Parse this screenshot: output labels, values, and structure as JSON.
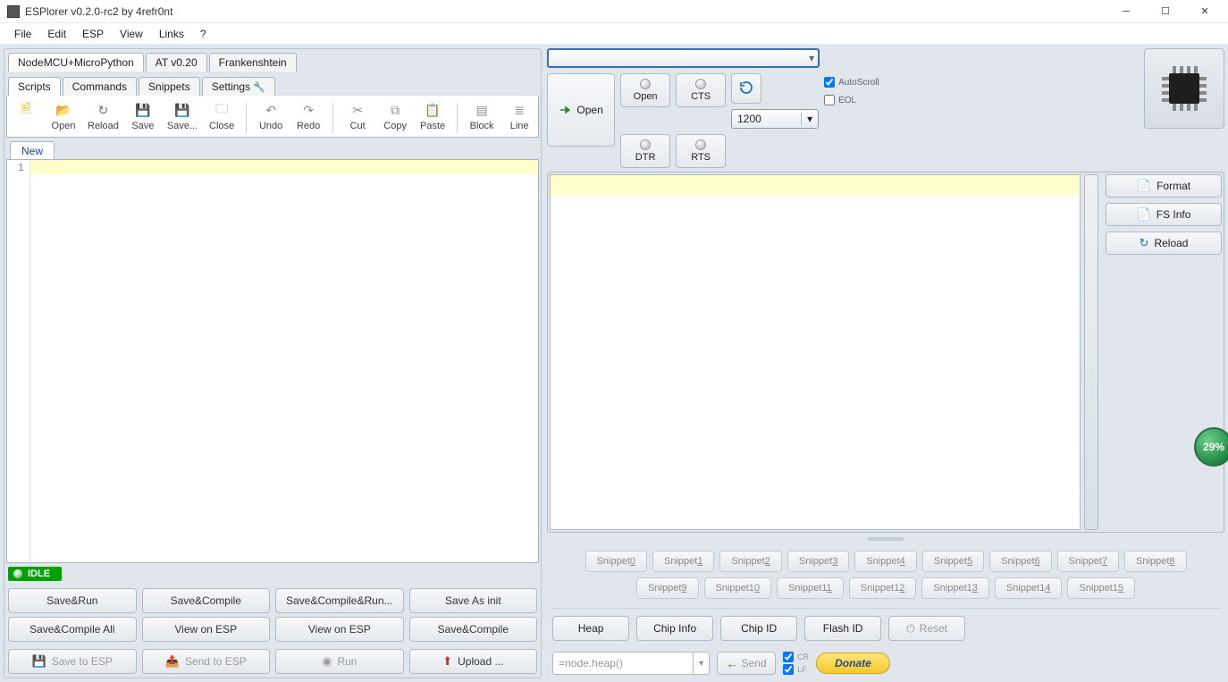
{
  "window": {
    "title": "ESPlorer v0.2.0-rc2 by 4refr0nt"
  },
  "menus": [
    "File",
    "Edit",
    "ESP",
    "View",
    "Links",
    "?"
  ],
  "firmware_tabs": [
    "NodeMCU+MicroPython",
    "AT v0.20",
    "Frankenshtein"
  ],
  "sub_tabs": [
    "Scripts",
    "Commands",
    "Snippets",
    "Settings"
  ],
  "toolbar": [
    {
      "id": "open-folder",
      "label": "Open",
      "glyph": "📂",
      "cls": "ic-folder-open"
    },
    {
      "id": "reload",
      "label": "Reload",
      "glyph": "↻",
      "cls": "ic-reload"
    },
    {
      "id": "save",
      "label": "Save",
      "glyph": "💾",
      "cls": "ic-save"
    },
    {
      "id": "saveas",
      "label": "Save...",
      "glyph": "💾",
      "cls": "ic-saveas"
    },
    {
      "id": "close",
      "label": "Close",
      "glyph": "🗀",
      "cls": "ic-close"
    },
    {
      "id": "SEP"
    },
    {
      "id": "undo",
      "label": "Undo",
      "glyph": "↶",
      "cls": "ic-undo"
    },
    {
      "id": "redo",
      "label": "Redo",
      "glyph": "↷",
      "cls": "ic-redo"
    },
    {
      "id": "SEP"
    },
    {
      "id": "cut",
      "label": "Cut",
      "glyph": "✂",
      "cls": "ic-cut"
    },
    {
      "id": "copy",
      "label": "Copy",
      "glyph": "⧉",
      "cls": "ic-copy"
    },
    {
      "id": "paste",
      "label": "Paste",
      "glyph": "📋",
      "cls": "ic-paste"
    },
    {
      "id": "SEP"
    },
    {
      "id": "block",
      "label": "Block",
      "glyph": "▤",
      "cls": "ic-block"
    },
    {
      "id": "line",
      "label": "Line",
      "glyph": "≣",
      "cls": "ic-line"
    }
  ],
  "new_file_icon": "🗎",
  "editor": {
    "tab": "New",
    "line_number": "1"
  },
  "status": "IDLE",
  "left_buttons_row1": [
    "Save&Run",
    "Save&Compile",
    "Save&Compile&Run...",
    "Save As init"
  ],
  "left_buttons_row2": [
    "Save&Compile All",
    "View on ESP",
    "View on ESP",
    "Save&Compile"
  ],
  "left_buttons_row3": [
    {
      "label": "Save to ESP",
      "dim": true
    },
    {
      "label": "Send to ESP",
      "dim": true
    },
    {
      "label": "Run",
      "dim": true
    },
    {
      "label": "Upload ..."
    }
  ],
  "serial": {
    "port": "",
    "baud": "1200",
    "open_label": "Open",
    "big_open": "Open",
    "cts": "CTS",
    "dtr": "DTR",
    "rts": "RTS",
    "autoscroll": "AutoScroll",
    "autoscroll_checked": true,
    "eol": "EOL",
    "eol_checked": false
  },
  "side_buttons": [
    {
      "label": "Format",
      "icon": "📄",
      "color": "#c0392b"
    },
    {
      "label": "FS Info",
      "icon": "📄",
      "color": "#d08b1a"
    },
    {
      "label": "Reload",
      "icon": "↻",
      "color": "#1a73c4"
    }
  ],
  "gauge": "29%",
  "snippets": [
    "Snippet0",
    "Snippet1",
    "Snippet2",
    "Snippet3",
    "Snippet4",
    "Snippet5",
    "Snippet6",
    "Snippet7",
    "Snippet8",
    "Snippet9",
    "Snippet10",
    "Snippet11",
    "Snippet12",
    "Snippet13",
    "Snippet14",
    "Snippet15"
  ],
  "chip_buttons": [
    "Heap",
    "Chip Info",
    "Chip ID",
    "Flash ID",
    "Reset"
  ],
  "cmd": {
    "placeholder": "=node.heap()",
    "send": "Send",
    "cr": "CR",
    "lf": "LF"
  },
  "donate": "Donate"
}
